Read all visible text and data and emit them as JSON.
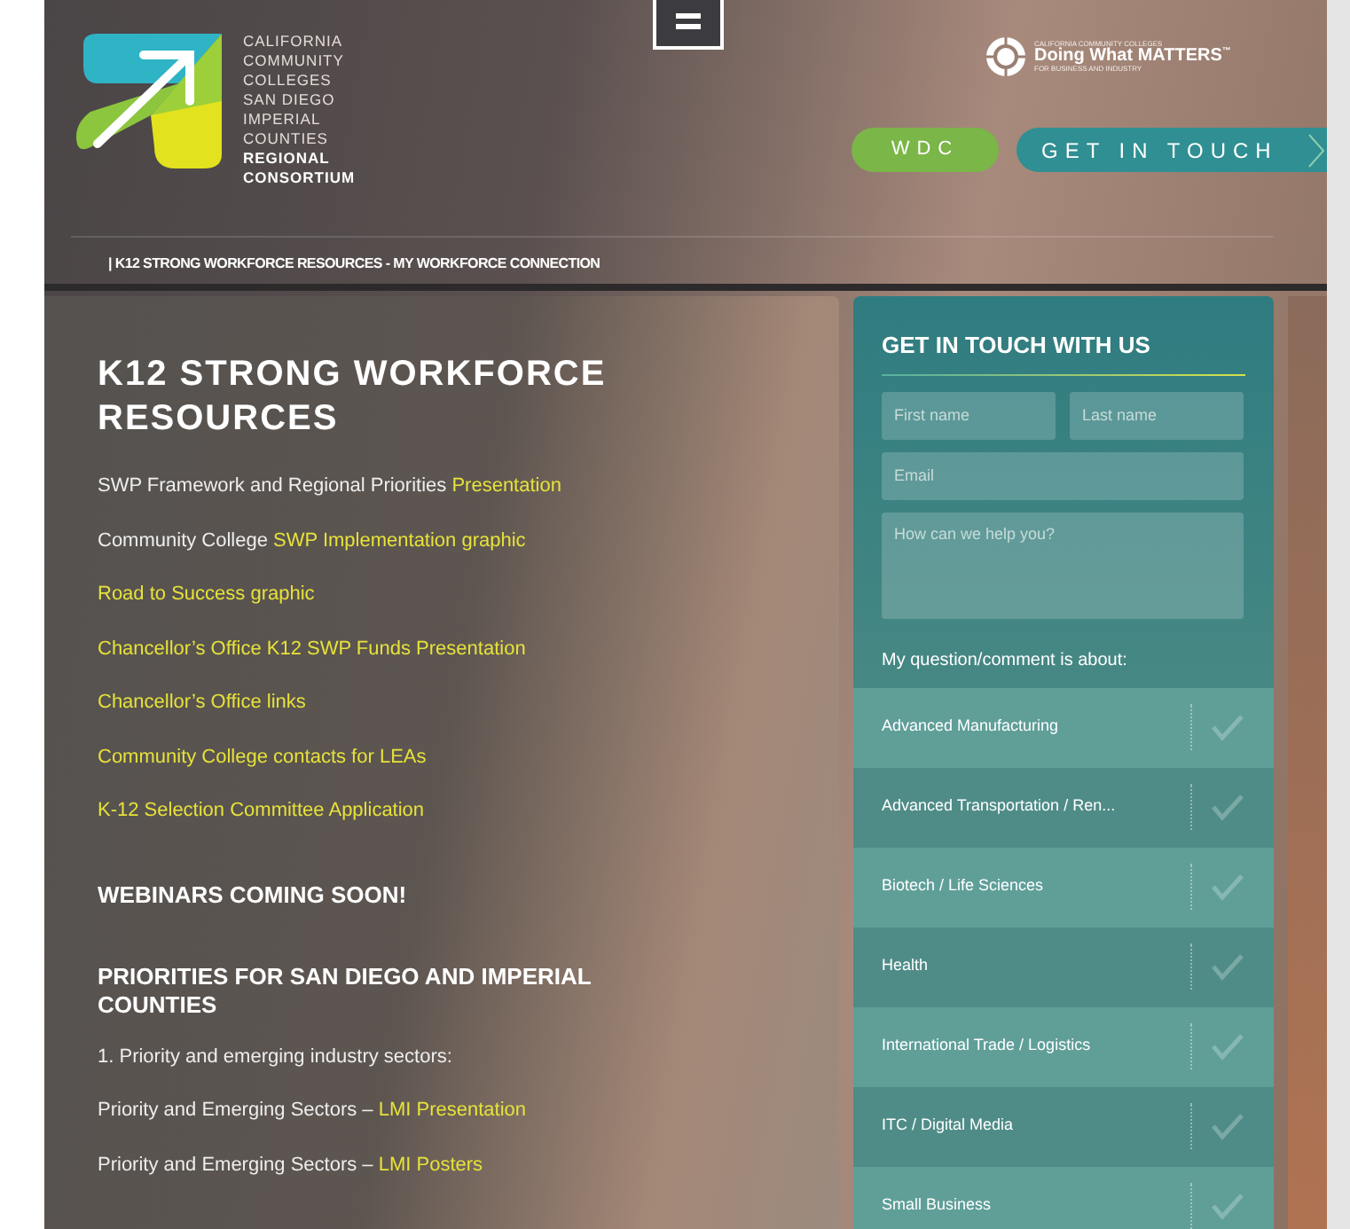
{
  "header": {
    "logo_lines": [
      {
        "text": "CALIFORNIA",
        "bold": false
      },
      {
        "text": "COMMUNITY",
        "bold": false
      },
      {
        "text": "COLLEGES",
        "bold": false
      },
      {
        "text": "SAN DIEGO",
        "bold": false
      },
      {
        "text": "IMPERIAL",
        "bold": false
      },
      {
        "text": "COUNTIES",
        "bold": false
      },
      {
        "text": "REGIONAL",
        "bold": true
      },
      {
        "text": "CONSORTIUM",
        "bold": true
      }
    ],
    "partner": {
      "kicker": "CALIFORNIA COMMUNITY COLLEGES",
      "name": "Doing What MATTERS",
      "trademark": "™",
      "tagline": "FOR BUSINESS AND INDUSTRY"
    },
    "buttons": [
      {
        "label": "WDC",
        "kind": "pill"
      },
      {
        "label": "GET IN TOUCH",
        "kind": "arrow"
      }
    ],
    "breadcrumb": "| K12 STRONG WORKFORCE RESOURCES - MY WORKFORCE CONNECTION"
  },
  "content": {
    "title": "K12 STRONG WORKFORCE RESOURCES",
    "lines": [
      {
        "kind": "line",
        "parts": [
          {
            "text": "SWP Framework and Regional Priorities ",
            "link": false
          },
          {
            "text": "Presentation",
            "link": true
          }
        ]
      },
      {
        "kind": "line",
        "parts": [
          {
            "text": "Community College ",
            "link": false
          },
          {
            "text": "SWP Implementation graphic",
            "link": true
          }
        ]
      },
      {
        "kind": "line",
        "parts": [
          {
            "text": "Road to Success graphic",
            "link": true
          }
        ]
      },
      {
        "kind": "line",
        "parts": [
          {
            "text": "Chancellor’s Office K12 SWP Funds Presentation",
            "link": true
          }
        ]
      },
      {
        "kind": "line",
        "parts": [
          {
            "text": "Chancellor’s Office links",
            "link": true
          }
        ]
      },
      {
        "kind": "line",
        "parts": [
          {
            "text": "Community College contacts for LEAs",
            "link": true
          }
        ]
      },
      {
        "kind": "line",
        "parts": [
          {
            "text": "K-12 Selection Committee Application",
            "link": true
          }
        ]
      },
      {
        "kind": "heading",
        "text": "WEBINARS COMING SOON!"
      },
      {
        "kind": "heading",
        "text": "PRIORITIES FOR SAN DIEGO AND IMPERIAL COUNTIES"
      },
      {
        "kind": "line",
        "parts": [
          {
            "text": "1. Priority and emerging industry sectors:",
            "link": false
          }
        ]
      },
      {
        "kind": "line",
        "parts": [
          {
            "text": "Priority and Emerging Sectors – ",
            "link": false
          },
          {
            "text": "LMI Presentation",
            "link": true
          }
        ]
      },
      {
        "kind": "line",
        "parts": [
          {
            "text": "Priority and Emerging Sectors – ",
            "link": false
          },
          {
            "text": "LMI Posters",
            "link": true
          }
        ]
      }
    ]
  },
  "form": {
    "title": "GET IN TOUCH WITH US",
    "first_name": {
      "placeholder": "First name"
    },
    "last_name": {
      "placeholder": "Last name"
    },
    "email": {
      "placeholder": "Email"
    },
    "message": {
      "placeholder": "How can we help you?"
    },
    "topic_label": "My question/comment is about:",
    "topics": [
      {
        "label": "Advanced Manufacturing",
        "checked": false
      },
      {
        "label": "Advanced Transportation / Ren...",
        "checked": false
      },
      {
        "label": "Biotech / Life Sciences",
        "checked": false
      },
      {
        "label": "Health",
        "checked": false
      },
      {
        "label": "International Trade / Logistics",
        "checked": false
      },
      {
        "label": "ITC / Digital Media",
        "checked": false
      },
      {
        "label": "Small Business",
        "checked": false
      }
    ]
  }
}
